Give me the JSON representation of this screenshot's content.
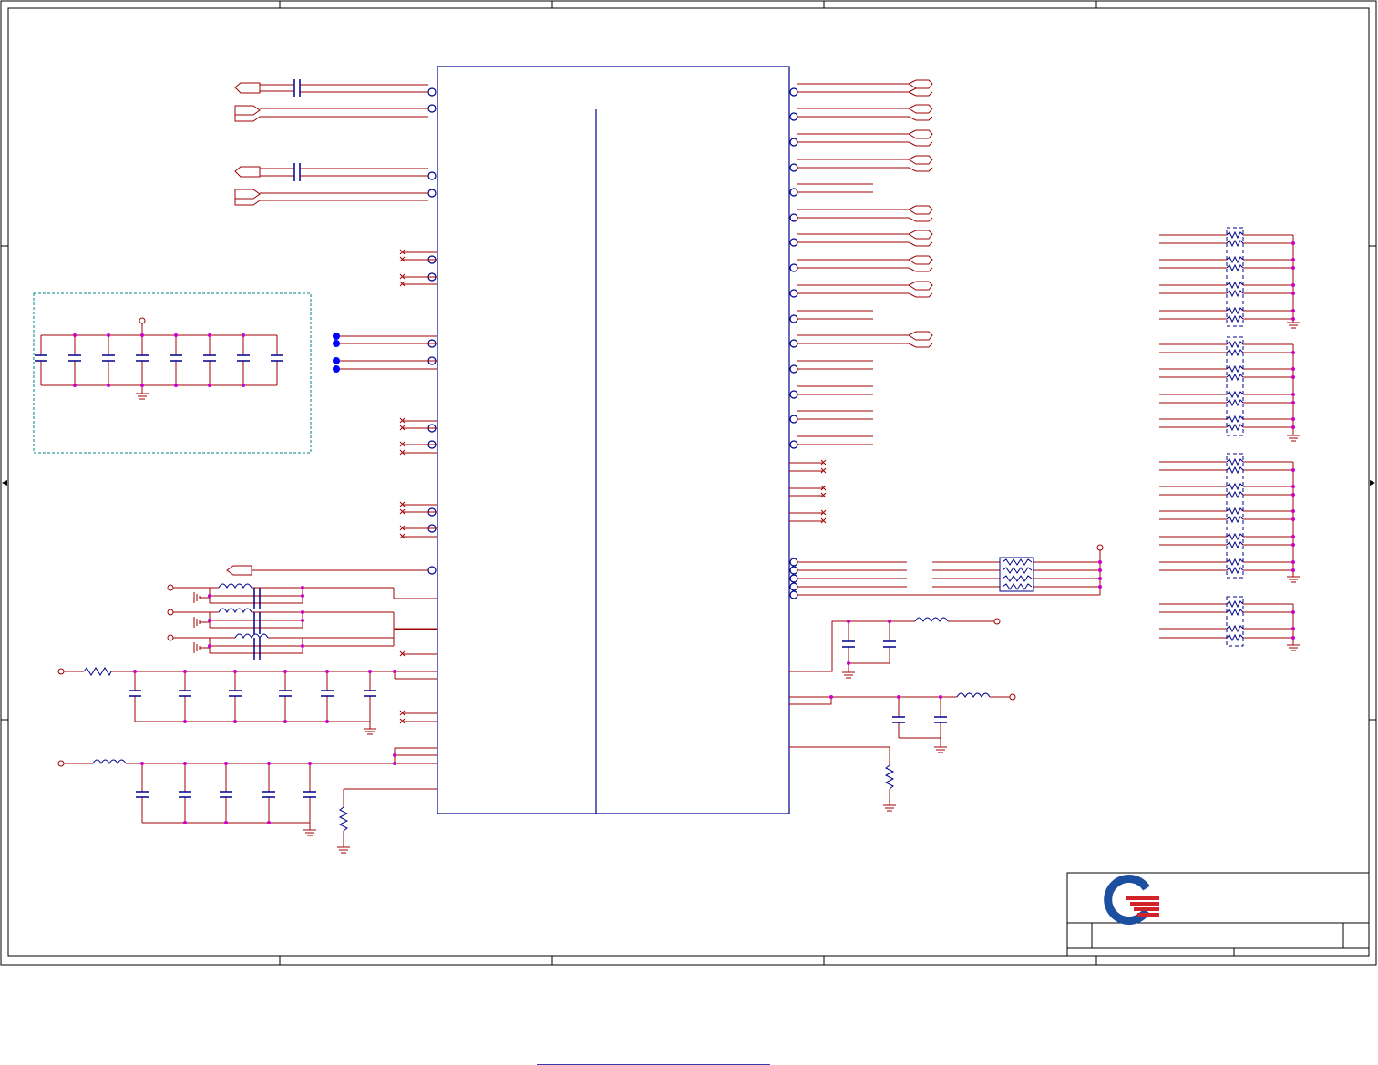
{
  "sheet": {
    "title_block_label": "",
    "rev": ""
  },
  "footer": {
    "link_text": ""
  },
  "colors": {
    "wire": "#a00000",
    "component": "#00008b",
    "junction": "#cc00cc",
    "net_dot": "#0000ff",
    "border": "#000000",
    "dashed_box": "#008080",
    "logo_blue": "#1c4fa0",
    "logo_red": "#d2232a"
  },
  "icons": {
    "logo": "quanta-logo-icon",
    "ground": "ground-symbol-icon",
    "capacitor": "capacitor-symbol-icon",
    "inductor": "inductor-symbol-icon",
    "resistor": "resistor-symbol-icon",
    "resistor_pack": "resistor-network-icon",
    "off_page": "offpage-connector-icon"
  }
}
